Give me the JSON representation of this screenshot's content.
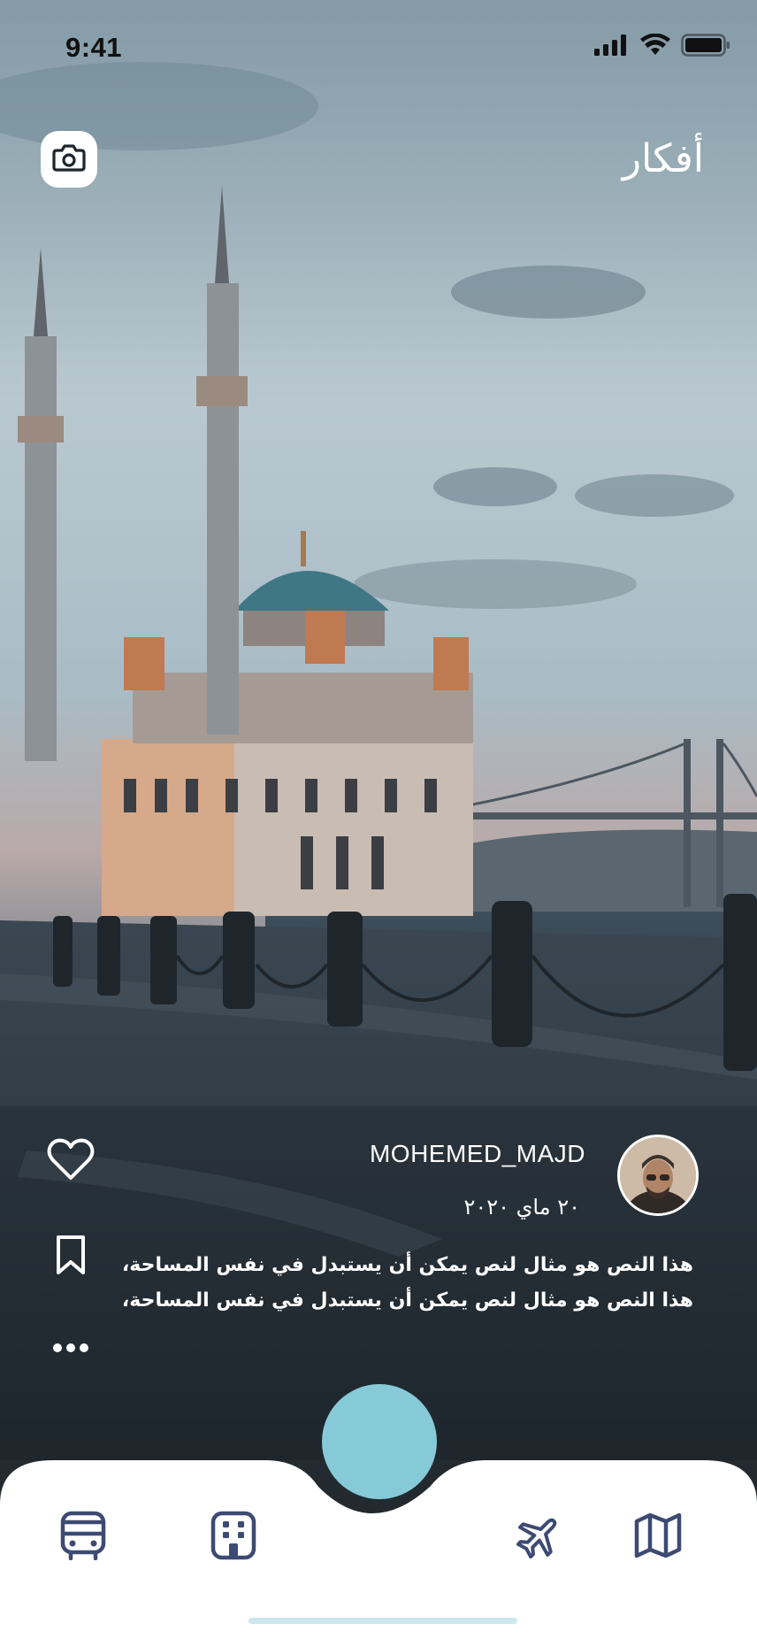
{
  "status_bar": {
    "time": "9:41"
  },
  "header": {
    "title": "أفكار",
    "camera_icon": "camera-icon"
  },
  "post": {
    "username": "MOHEMED_MAJD",
    "date": "٢٠ ماي ٢٠٢٠",
    "caption_lines": [
      "هذا النص هو مثال لنص يمكن أن يستبدل في نفس المساحة،",
      "هذا النص هو مثال لنص يمكن أن يستبدل في نفس المساحة،"
    ]
  },
  "actions": {
    "like_icon": "heart-icon",
    "save_icon": "bookmark-icon",
    "more_icon": "more-dots-icon"
  },
  "bottom_nav": {
    "items": [
      "bus-icon",
      "building-icon",
      "airplane-icon",
      "map-icon"
    ],
    "fab_color": "#86cad8",
    "icon_color": "#3d4a73"
  }
}
